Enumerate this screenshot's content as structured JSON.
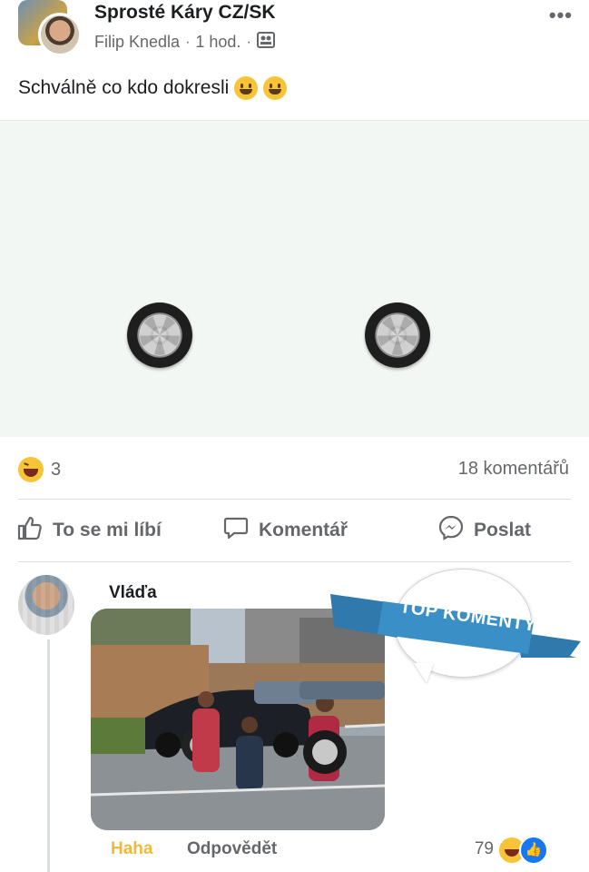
{
  "post": {
    "group_name": "Sprosté Káry CZ/SK",
    "author": "Filip Knedla",
    "time": "1 hod.",
    "separator": "·",
    "text": "Schválně co kdo dokresli",
    "more_label": "•••"
  },
  "stats": {
    "reaction_count": "3",
    "comments": "18 komentářů"
  },
  "actions": {
    "like": "To se mi líbí",
    "comment": "Komentář",
    "share": "Poslat"
  },
  "comment": {
    "author": "Vláďa",
    "haha_label": "Haha",
    "reply_label": "Odpovědět",
    "reaction_count": "79"
  },
  "badge": {
    "text": "TOP KOMENTY"
  },
  "colors": {
    "accent": "#1877f2",
    "haha": "#f0b93b",
    "ribbon": "#3a8fc7"
  },
  "icons": {
    "like": "thumbs-up-icon",
    "comment": "speech-bubble-icon",
    "share": "messenger-icon",
    "audience": "group-members-icon"
  }
}
